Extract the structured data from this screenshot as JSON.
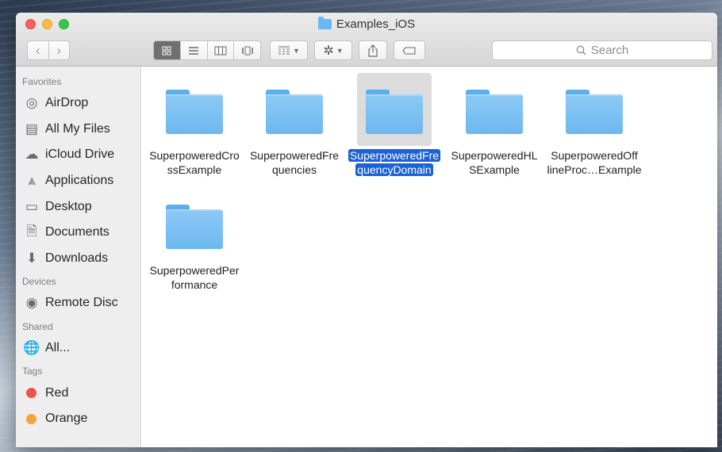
{
  "window": {
    "title": "Examples_iOS",
    "traffic_lights": [
      "close",
      "minimize",
      "zoom"
    ]
  },
  "toolbar": {
    "back_icon": "‹",
    "forward_icon": "›",
    "view_modes": [
      "icon-view-icon",
      "list-view-icon",
      "column-view-icon",
      "cover-flow-icon"
    ],
    "active_view": "icon-view-icon",
    "arrange_icon": "arrange-icon",
    "action_icon": "gear-icon",
    "share_icon": "share-icon",
    "tag_icon": "tag-icon",
    "search_placeholder": "Search"
  },
  "sidebar": {
    "favorites_header": "Favorites",
    "favorites": [
      {
        "label": "AirDrop",
        "icon": "airdrop-icon",
        "glyph": "◎"
      },
      {
        "label": "All My Files",
        "icon": "all-files-icon",
        "glyph": "▤"
      },
      {
        "label": "iCloud Drive",
        "icon": "cloud-icon",
        "glyph": "☁"
      },
      {
        "label": "Applications",
        "icon": "applications-icon",
        "glyph": "⩓"
      },
      {
        "label": "Desktop",
        "icon": "desktop-icon",
        "glyph": "▭"
      },
      {
        "label": "Documents",
        "icon": "documents-icon",
        "glyph": "🗎"
      },
      {
        "label": "Downloads",
        "icon": "downloads-icon",
        "glyph": "⬇"
      }
    ],
    "devices_header": "Devices",
    "devices": [
      {
        "label": "Remote Disc",
        "icon": "disc-icon",
        "glyph": "◉"
      }
    ],
    "shared_header": "Shared",
    "shared": [
      {
        "label": "All...",
        "icon": "network-icon",
        "glyph": "🌐"
      }
    ],
    "tags_header": "Tags",
    "tags": [
      {
        "label": "Red",
        "color": "#f0534a"
      },
      {
        "label": "Orange",
        "color": "#f7a33a"
      }
    ]
  },
  "files": [
    {
      "line1": "SuperpoweredCro",
      "line2": "ssExample",
      "selected": false
    },
    {
      "line1": "SuperpoweredFre",
      "line2": "quencies",
      "selected": false
    },
    {
      "line1": "SuperpoweredFre",
      "line2": "quencyDomain",
      "selected": true
    },
    {
      "line1": "SuperpoweredHL",
      "line2": "SExample",
      "selected": false
    },
    {
      "line1": "SuperpoweredOff",
      "line2": "lineProc…Example",
      "selected": false
    },
    {
      "line1": "SuperpoweredPer",
      "line2": "formance",
      "selected": false
    }
  ],
  "colors": {
    "selection": "#1b62d6",
    "folder": "#6cb8f0",
    "close": "#fc605c",
    "minimize": "#fdbc40",
    "zoom": "#34c84a"
  }
}
